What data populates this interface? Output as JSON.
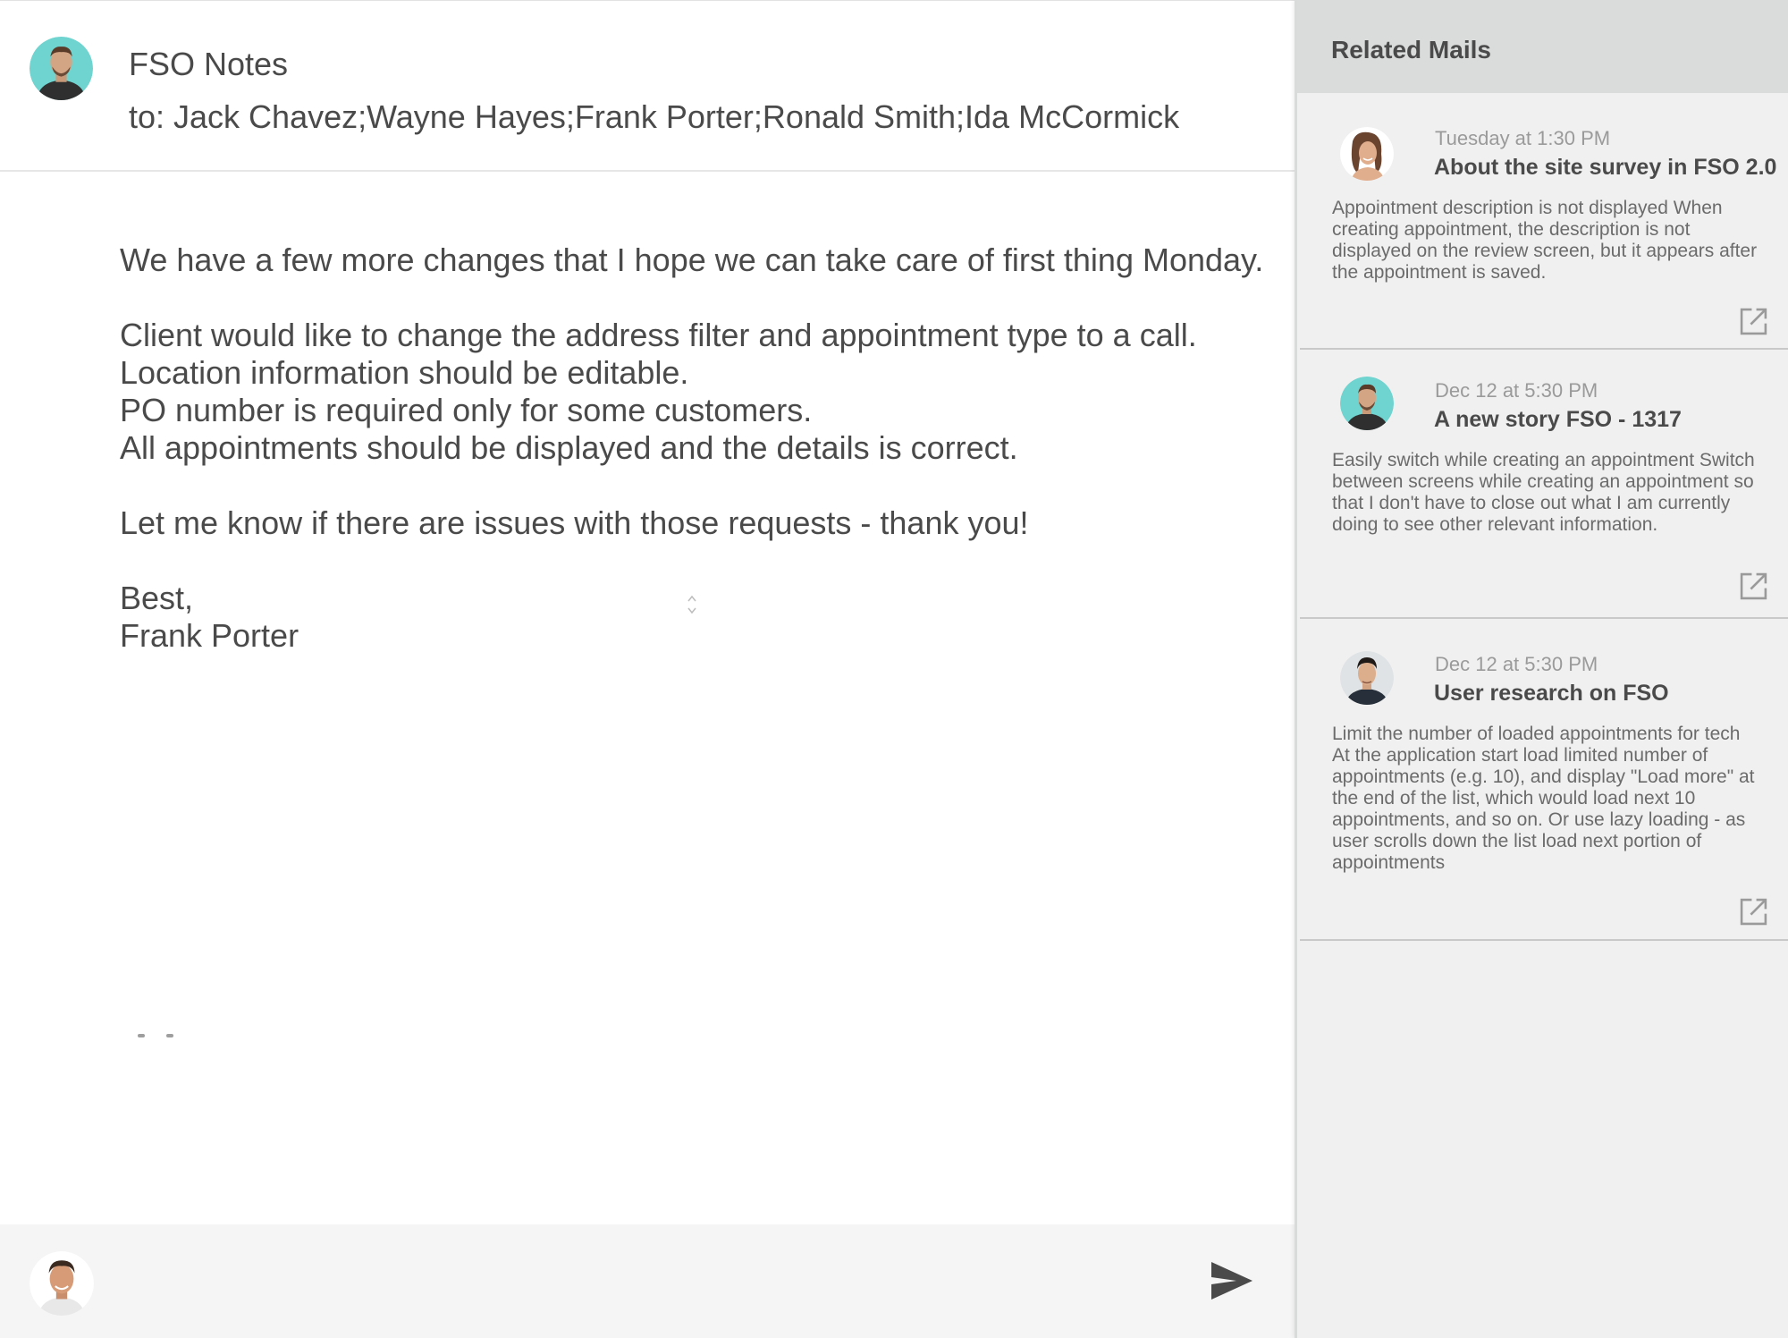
{
  "mail": {
    "subject": "FSO Notes",
    "recipients": "to: Jack Chavez;Wayne Hayes;Frank Porter;Ronald Smith;Ida McCormick",
    "body": {
      "line1": "We have a few more changes that I hope we can take care of first thing Monday.",
      "line2": "Client would like to change the address filter and appointment type to a call.",
      "line3": "Location information should be editable.",
      "line4": "PO number is required only for some customers.",
      "line5": "All appointments should be displayed and the details is correct.",
      "line6": "Let me know if there are issues with those requests - thank you!",
      "closing": "Best,",
      "signature": "Frank Porter"
    }
  },
  "reply": {
    "send_icon": "send-icon"
  },
  "related": {
    "title": "Related Mails",
    "items": [
      {
        "time": "Tuesday at 1:30 PM",
        "title": "About the site survey in FSO 2.0",
        "snippet": "Appointment description is not displayed When creating appointment, the description is not displayed on the review screen, but it appears after the appointment is saved.",
        "icon": "open-external-icon"
      },
      {
        "time": "Dec 12 at 5:30 PM",
        "title": "A new story FSO - 1317",
        "snippet": "Easily switch while creating an appointment Switch between screens while creating an appointment so that I don't have to close out what I am currently doing to see other relevant information.",
        "icon": "open-external-icon"
      },
      {
        "time": "Dec 12 at 5:30 PM",
        "title": "User research on FSO",
        "snippet": "Limit the number of loaded appointments for tech At the application start load limited number of appointments (e.g. 10), and display \"Load more\" at the end of the list, which would load next 10 appointments, and so on. Or use lazy loading - as user scrolls down the list load next portion of appointments",
        "icon": "open-external-icon"
      }
    ]
  },
  "colors": {
    "text": "#4a4a4a",
    "muted": "#9a9a9a",
    "sidebar_bg": "#f0f0f0",
    "sidebar_header_bg": "#d9dcdb",
    "reply_bar_bg": "#f5f5f5"
  }
}
